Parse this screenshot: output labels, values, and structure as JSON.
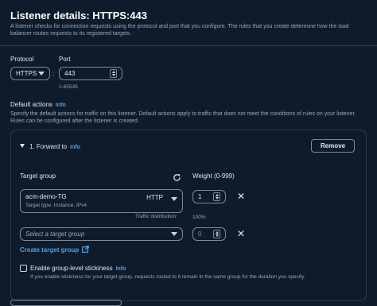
{
  "header": {
    "title": "Listener details: HTTPS:443",
    "description": "A listener checks for connection requests using the protocol and port that you configure. The rules that you create determine how the load balancer routes requests to its registered targets."
  },
  "protocol": {
    "label": "Protocol",
    "value": "HTTPS",
    "separator": ":"
  },
  "port": {
    "label": "Port",
    "value": "443",
    "hint": "1-65535"
  },
  "default_actions": {
    "label": "Default actions",
    "info": "Info",
    "description": "Specify the default actions for traffic on this listener. Default actions apply to traffic that does not meet the conditions of rules on your listener. Rules can be configured after the listener is created."
  },
  "action": {
    "label": "1. Forward to",
    "info": "Info",
    "remove_label": "Remove",
    "target_group_label": "Target group",
    "weight_label": "Weight (0-999)",
    "rows": [
      {
        "name": "acm-demo-TG",
        "protocol": "HTTP",
        "subtitle": "Target type: Instance, IPv4",
        "weight": "1"
      },
      {
        "placeholder": "Select a target group",
        "weight": "0"
      }
    ],
    "traffic_distribution_label": "Traffic distribution:",
    "traffic_distribution_value": "100%",
    "create_target_group": "Create target group",
    "stickiness_label": "Enable group-level stickiness",
    "stickiness_info": "Info",
    "stickiness_hint": "If you enable stickiness for your target group, requests routed to it remain in the same group for the duration you specify."
  },
  "icons": {
    "refresh": "refresh-icon",
    "remove_row": "close-icon",
    "external": "external-link-icon",
    "expand": "caret-down-icon"
  }
}
